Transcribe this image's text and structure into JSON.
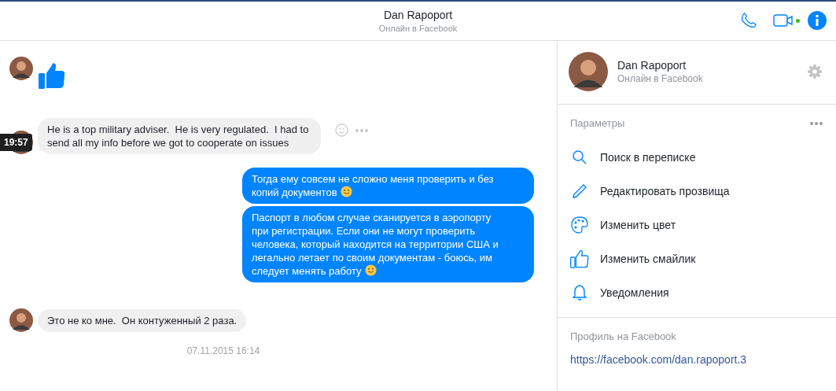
{
  "header": {
    "name": "Dan Rapoport",
    "status": "Онлайн в Facebook",
    "video_online": true
  },
  "messages": [
    {
      "kind": "like"
    },
    {
      "kind": "incoming",
      "text": "He is a top military adviser.  He is very regulated.  I had to send all my info before we got to cooperate on issues",
      "tooltip": "19:57",
      "hovered": true
    },
    {
      "kind": "outgoing",
      "text": "Тогда ему совсем не сложно меня проверить и без копий документов",
      "smiley": true
    },
    {
      "kind": "outgoing",
      "text": "Паспорт в любом случае сканируется в аэропорту при регистрации. Если они не могут проверить человека, который находится на территории США и легально летает по своим документам - боюсь, им следует менять работу",
      "smiley": true
    },
    {
      "kind": "incoming",
      "text": "Это не ко мне.  Он контуженный 2 раза."
    },
    {
      "kind": "timestamp",
      "text": "07.11.2015 16:14"
    }
  ],
  "sidebar": {
    "name": "Dan Rapoport",
    "status": "Онлайн в Facebook",
    "options_title": "Параметры",
    "options": [
      {
        "label": "Поиск в переписке"
      },
      {
        "label": "Редактировать прозвища"
      },
      {
        "label": "Изменить цвет"
      },
      {
        "label": "Изменить смайлик"
      },
      {
        "label": "Уведомления"
      }
    ],
    "profile_title": "Профиль на Facebook",
    "profile_link": "https://facebook.com/dan.rapoport.3"
  }
}
